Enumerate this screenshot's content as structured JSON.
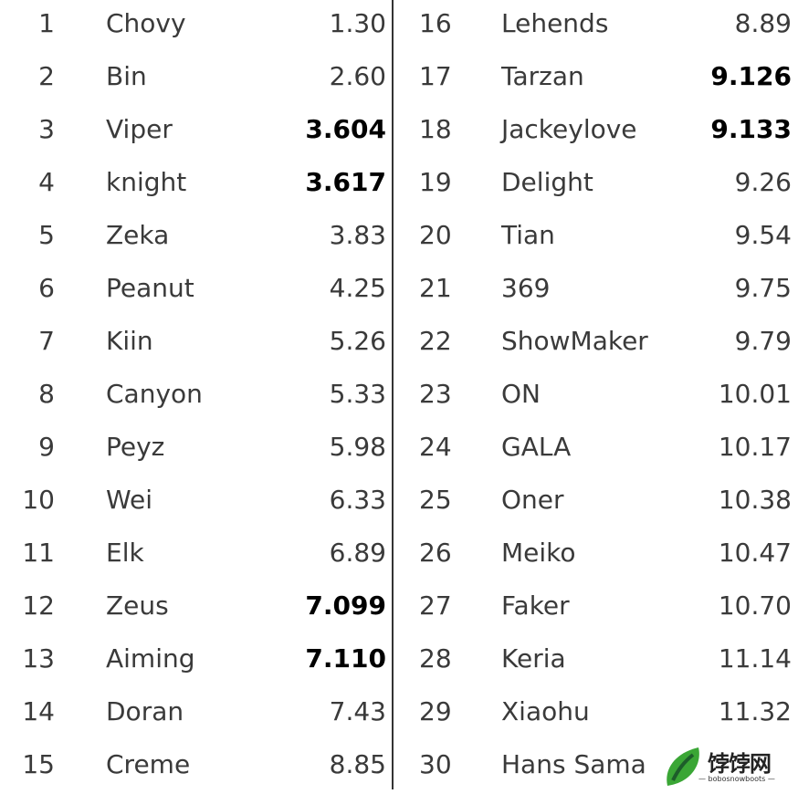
{
  "left_rows": [
    {
      "rank": "1",
      "name": "Chovy",
      "value": "1.30",
      "bold": false
    },
    {
      "rank": "2",
      "name": "Bin",
      "value": "2.60",
      "bold": false
    },
    {
      "rank": "3",
      "name": "Viper",
      "value": "3.604",
      "bold": true
    },
    {
      "rank": "4",
      "name": "knight",
      "value": "3.617",
      "bold": true
    },
    {
      "rank": "5",
      "name": "Zeka",
      "value": "3.83",
      "bold": false
    },
    {
      "rank": "6",
      "name": "Peanut",
      "value": "4.25",
      "bold": false
    },
    {
      "rank": "7",
      "name": "Kiin",
      "value": "5.26",
      "bold": false
    },
    {
      "rank": "8",
      "name": "Canyon",
      "value": "5.33",
      "bold": false
    },
    {
      "rank": "9",
      "name": "Peyz",
      "value": "5.98",
      "bold": false
    },
    {
      "rank": "10",
      "name": "Wei",
      "value": "6.33",
      "bold": false
    },
    {
      "rank": "11",
      "name": "Elk",
      "value": "6.89",
      "bold": false
    },
    {
      "rank": "12",
      "name": "Zeus",
      "value": "7.099",
      "bold": true
    },
    {
      "rank": "13",
      "name": "Aiming",
      "value": "7.110",
      "bold": true
    },
    {
      "rank": "14",
      "name": "Doran",
      "value": "7.43",
      "bold": false
    },
    {
      "rank": "15",
      "name": "Creme",
      "value": "8.85",
      "bold": false
    }
  ],
  "right_rows": [
    {
      "rank": "16",
      "name": "Lehends",
      "value": "8.89",
      "bold": false
    },
    {
      "rank": "17",
      "name": "Tarzan",
      "value": "9.126",
      "bold": true
    },
    {
      "rank": "18",
      "name": "Jackeylove",
      "value": "9.133",
      "bold": true
    },
    {
      "rank": "19",
      "name": "Delight",
      "value": "9.26",
      "bold": false
    },
    {
      "rank": "20",
      "name": "Tian",
      "value": "9.54",
      "bold": false
    },
    {
      "rank": "21",
      "name": "369",
      "value": "9.75",
      "bold": false
    },
    {
      "rank": "22",
      "name": "ShowMaker",
      "value": "9.79",
      "bold": false
    },
    {
      "rank": "23",
      "name": "ON",
      "value": "10.01",
      "bold": false
    },
    {
      "rank": "24",
      "name": "GALA",
      "value": "10.17",
      "bold": false
    },
    {
      "rank": "25",
      "name": "Oner",
      "value": "10.38",
      "bold": false
    },
    {
      "rank": "26",
      "name": "Meiko",
      "value": "10.47",
      "bold": false
    },
    {
      "rank": "27",
      "name": "Faker",
      "value": "10.70",
      "bold": false
    },
    {
      "rank": "28",
      "name": "Keria",
      "value": "11.14",
      "bold": false
    },
    {
      "rank": "29",
      "name": "Xiaohu",
      "value": "11.32",
      "bold": false
    },
    {
      "rank": "30",
      "name": "Hans Sama",
      "value": "",
      "bold": false
    }
  ],
  "watermark": {
    "title": "饽饽网",
    "subtitle": "— bobosnowboots —",
    "leaf_color": "#3aa635"
  }
}
